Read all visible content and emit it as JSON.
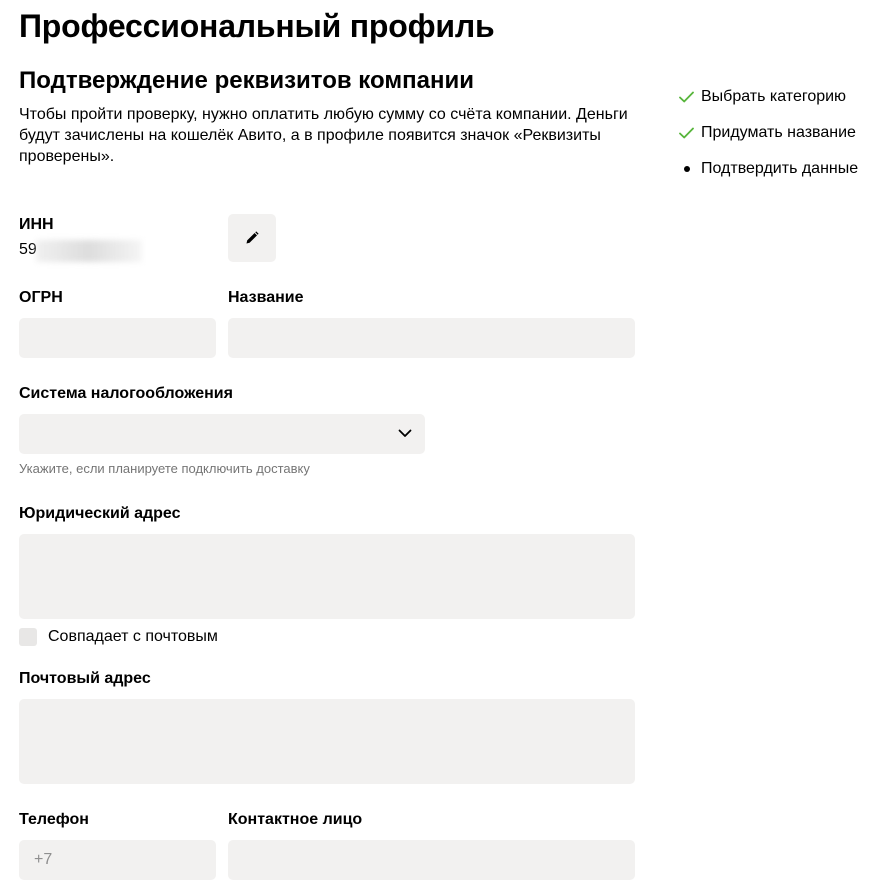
{
  "page": {
    "title": "Профессиональный профиль"
  },
  "section": {
    "title": "Подтверждение реквизитов компании",
    "intro": "Чтобы пройти проверку, нужно оплатить любую сумму со счёта компании. Деньги будут зачислены на кошелёк Авито, а в профиле появится значок «Реквизиты проверены»."
  },
  "steps": [
    {
      "label": "Выбрать категорию",
      "state": "done",
      "icon": "check-icon"
    },
    {
      "label": "Придумать название",
      "state": "done",
      "icon": "check-icon"
    },
    {
      "label": "Подтвердить данные",
      "state": "current",
      "icon": "bullet-icon"
    }
  ],
  "form": {
    "inn": {
      "label": "ИНН",
      "value_visible": "59"
    },
    "ogrn": {
      "label": "ОГРН",
      "value": ""
    },
    "name": {
      "label": "Название",
      "value": ""
    },
    "tax_system": {
      "label": "Система налогообложения",
      "value": "",
      "hint": "Укажите, если планируете подключить доставку"
    },
    "legal_address": {
      "label": "Юридический адрес",
      "value": ""
    },
    "same_as_postal": {
      "label": "Совпадает с почтовым",
      "checked": false
    },
    "postal_address": {
      "label": "Почтовый адрес",
      "value": ""
    },
    "phone": {
      "label": "Телефон",
      "placeholder": "+7"
    },
    "contact_person": {
      "label": "Контактное лицо",
      "value": ""
    }
  },
  "colors": {
    "accent_check": "#57b53b",
    "field_bg": "#f2f1f0",
    "hint_text": "#757575"
  }
}
